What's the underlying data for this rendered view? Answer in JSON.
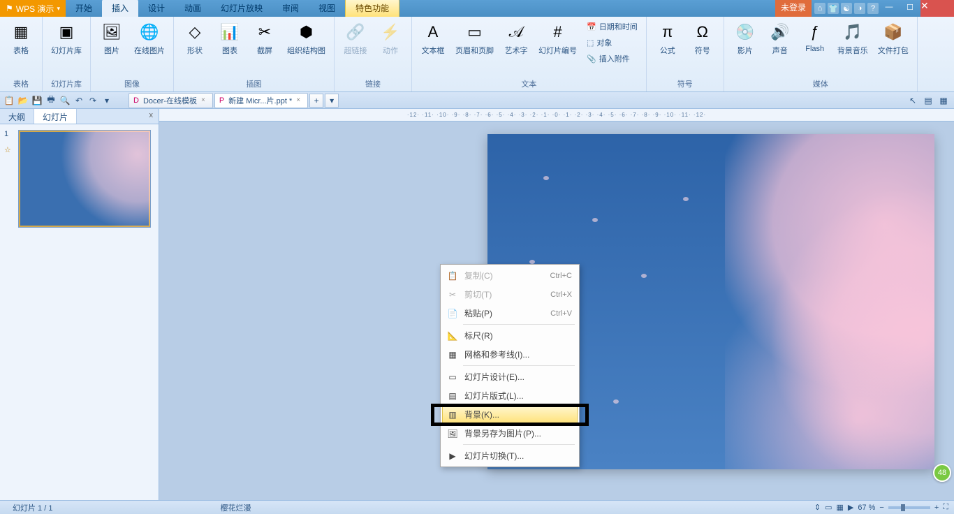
{
  "app_name": "WPS 演示",
  "menu_tabs": [
    "开始",
    "插入",
    "设计",
    "动画",
    "幻灯片放映",
    "审阅",
    "视图",
    "特色功能"
  ],
  "active_menu": 1,
  "login_badge": "未登录",
  "ribbon": {
    "groups": [
      {
        "label": "表格",
        "items": [
          {
            "icon": "▦",
            "label": "表格"
          }
        ]
      },
      {
        "label": "幻灯片库",
        "items": [
          {
            "icon": "▣",
            "label": "幻灯片库"
          }
        ]
      },
      {
        "label": "图像",
        "items": [
          {
            "icon": "🖼",
            "label": "图片"
          },
          {
            "icon": "🌐",
            "label": "在线图片"
          }
        ]
      },
      {
        "label": "插图",
        "items": [
          {
            "icon": "◇",
            "label": "形状"
          },
          {
            "icon": "📊",
            "label": "图表"
          },
          {
            "icon": "✂",
            "label": "截屏"
          },
          {
            "icon": "⬢",
            "label": "组织结构图"
          }
        ]
      },
      {
        "label": "链接",
        "items": [
          {
            "icon": "🔗",
            "label": "超链接",
            "disabled": true
          },
          {
            "icon": "⚡",
            "label": "动作",
            "disabled": true
          }
        ]
      },
      {
        "label": "文本",
        "items": [
          {
            "icon": "A",
            "label": "文本框"
          },
          {
            "icon": "▭",
            "label": "页眉和页脚"
          },
          {
            "icon": "𝒜",
            "label": "艺术字"
          },
          {
            "icon": "#",
            "label": "幻灯片编号"
          }
        ],
        "vstack": [
          {
            "icon": "📅",
            "label": "日期和时间"
          },
          {
            "icon": "⬚",
            "label": "对象"
          },
          {
            "icon": "📎",
            "label": "插入附件"
          }
        ]
      },
      {
        "label": "符号",
        "items": [
          {
            "icon": "π",
            "label": "公式"
          },
          {
            "icon": "Ω",
            "label": "符号"
          }
        ]
      },
      {
        "label": "媒体",
        "items": [
          {
            "icon": "💿",
            "label": "影片"
          },
          {
            "icon": "🔊",
            "label": "声音"
          },
          {
            "icon": "ƒ",
            "label": "Flash"
          },
          {
            "icon": "🎵",
            "label": "背景音乐"
          },
          {
            "icon": "📦",
            "label": "文件打包"
          }
        ]
      }
    ]
  },
  "doc_tabs": [
    {
      "icon": "D",
      "label": "Docer-在线模板",
      "active": false
    },
    {
      "icon": "P",
      "label": "新建 Micr...片.ppt *",
      "active": true
    }
  ],
  "doc_add": "+",
  "left_pane": {
    "tabs": [
      "大纲",
      "幻灯片"
    ],
    "active": 1,
    "close": "x",
    "thumb_num": "1",
    "star": "☆"
  },
  "ruler_h": "·12· ·11· ·10· ·9· ·8· ·7· ·6· ·5· ·4· ·3· ·2· ·1· ·0· ·1· ·2· ·3· ·4· ·5· ·6· ·7· ·8· ·9· ·10· ·11· ·12·",
  "context_menu": [
    {
      "icon": "📋",
      "label": "复制(C)",
      "shortcut": "Ctrl+C",
      "disabled": true
    },
    {
      "icon": "✂",
      "label": "剪切(T)",
      "shortcut": "Ctrl+X",
      "disabled": true
    },
    {
      "icon": "📄",
      "label": "粘贴(P)",
      "shortcut": "Ctrl+V"
    },
    {
      "sep": true
    },
    {
      "icon": "📐",
      "label": "标尺(R)"
    },
    {
      "icon": "▦",
      "label": "网格和参考线(I)..."
    },
    {
      "sep": true
    },
    {
      "icon": "▭",
      "label": "幻灯片设计(E)..."
    },
    {
      "icon": "▤",
      "label": "幻灯片版式(L)..."
    },
    {
      "icon": "▥",
      "label": "背景(K)...",
      "highlighted": true
    },
    {
      "icon": "🖼",
      "label": "背景另存为图片(P)..."
    },
    {
      "sep": true
    },
    {
      "icon": "▶",
      "label": "幻灯片切换(T)..."
    }
  ],
  "statusbar": {
    "slide_info": "幻灯片 1 / 1",
    "title": "樱花烂漫",
    "zoom": "67 %"
  },
  "notif": "48"
}
